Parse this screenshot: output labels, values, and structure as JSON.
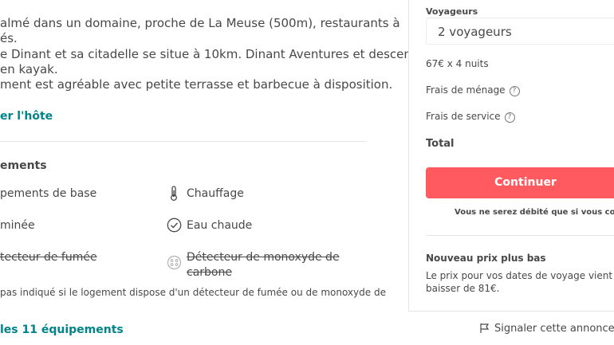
{
  "description": {
    "lines": [
      "almé dans un domaine, proche de La Meuse (500m), restaurants à",
      "és.",
      "e Dinant et sa citadelle se situe à 10km. Dinant Aventures et descente de",
      "en kayak.",
      "ment est agréable avec petite terrasse et barbecue à disposition."
    ],
    "contact_link": "er l'hôte"
  },
  "amenities": {
    "title": "ements",
    "items": [
      {
        "label": "pements de base",
        "icon": "none",
        "strikethrough": false
      },
      {
        "label": "Chauffage",
        "icon": "thermometer-icon",
        "strikethrough": false
      },
      {
        "label": "minée",
        "icon": "none",
        "strikethrough": false
      },
      {
        "label": "Eau chaude",
        "icon": "check-circle-icon",
        "strikethrough": false
      },
      {
        "label": "tecteur de fumée",
        "icon": "none",
        "strikethrough": true
      },
      {
        "label": "Détecteur de monoxyde de",
        "label_line2": "carbone",
        "icon": "co-detector-icon",
        "strikethrough": true
      }
    ],
    "note": "pas indiqué si le logement dispose d'un détecteur de fumée ou de monoxyde de",
    "show_all": "les 11 équipements"
  },
  "booking": {
    "guests_label": "Voyageurs",
    "guests_value": "2 voyageurs",
    "nightly": "67€ x 4 nuits",
    "cleaning_fee": "Frais de ménage",
    "service_fee": "Frais de service",
    "help_glyph": "?",
    "total": "Total",
    "continue": "Continuer",
    "disclaimer": "Vous ne serez débité que si vous confirme",
    "new_price_title": "Nouveau prix plus bas",
    "new_price_line1": "Le prix pour vos dates de voyage vient de",
    "new_price_line2": "baisser de 81€.",
    "accent": "#ff5a5f"
  },
  "report": {
    "label": "Signaler cette annonce",
    "icon": "flag-icon"
  }
}
